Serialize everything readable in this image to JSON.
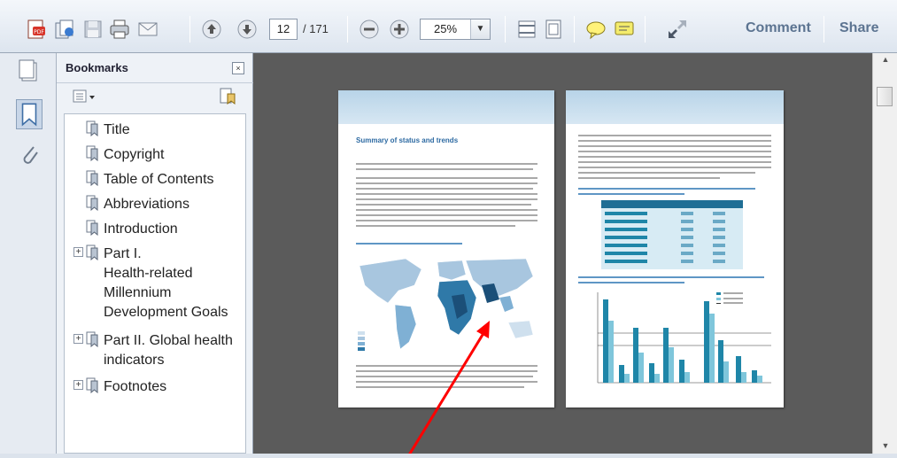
{
  "toolbar": {
    "page_current": "12",
    "page_total": "/ 171",
    "zoom": "25%",
    "comment": "Comment",
    "share": "Share"
  },
  "bookmarks": {
    "title": "Bookmarks",
    "close_glyph": "×",
    "items": [
      {
        "label": "Title"
      },
      {
        "label": "Copyright"
      },
      {
        "label": "Table of Contents"
      },
      {
        "label": "Abbreviations"
      },
      {
        "label": "Introduction"
      },
      {
        "label_lines": [
          "Part I.",
          "Health-related",
          "Millennium",
          "Development Goals"
        ],
        "expand": "+"
      },
      {
        "label_lines": [
          "Part II. Global health",
          "indicators"
        ],
        "expand": "+"
      },
      {
        "label": "Footnotes",
        "expand": "+"
      }
    ]
  },
  "document": {
    "left_page_heading": "Summary of status and trends",
    "colors": {
      "band": "#c9dff0",
      "heading": "#2d6aa2",
      "bars_dark": "#1f86a8",
      "bars_light": "#7fc6db",
      "background": "#5b5b5b"
    }
  },
  "annotation": {
    "arrow_color": "#ff0000"
  }
}
